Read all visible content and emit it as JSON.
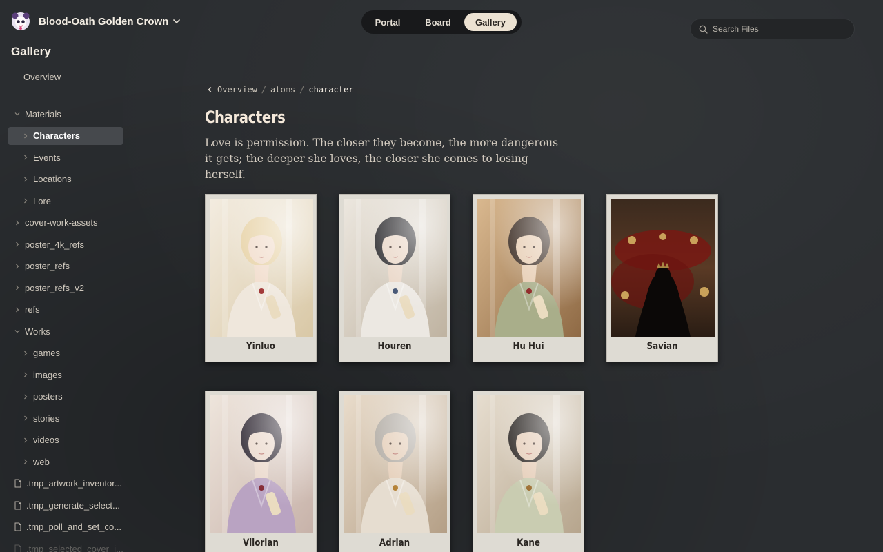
{
  "project": {
    "name": "Blood-Oath Golden Crown",
    "logo_icon": "skull-avatar-icon"
  },
  "nav": {
    "tabs": [
      "Portal",
      "Board",
      "Gallery"
    ],
    "active": "Gallery"
  },
  "search": {
    "placeholder": "Search Files"
  },
  "sidebar": {
    "section_title": "Gallery",
    "overview_label": "Overview",
    "tree": [
      {
        "label": "Materials",
        "type": "folder",
        "expanded": true
      },
      {
        "label": "Characters",
        "type": "folder",
        "active": true
      },
      {
        "label": "Events",
        "type": "folder"
      },
      {
        "label": "Locations",
        "type": "folder"
      },
      {
        "label": "Lore",
        "type": "folder"
      },
      {
        "label": "cover-work-assets",
        "type": "folder"
      },
      {
        "label": "poster_4k_refs",
        "type": "folder"
      },
      {
        "label": "poster_refs",
        "type": "folder"
      },
      {
        "label": "poster_refs_v2",
        "type": "folder"
      },
      {
        "label": "refs",
        "type": "folder"
      },
      {
        "label": "Works",
        "type": "folder",
        "expanded": true
      },
      {
        "label": "games",
        "type": "folder"
      },
      {
        "label": "images",
        "type": "folder"
      },
      {
        "label": "posters",
        "type": "folder"
      },
      {
        "label": "stories",
        "type": "folder"
      },
      {
        "label": "videos",
        "type": "folder"
      },
      {
        "label": "web",
        "type": "folder"
      },
      {
        "label": ".tmp_artwork_inventor...",
        "type": "file"
      },
      {
        "label": ".tmp_generate_select...",
        "type": "file"
      },
      {
        "label": ".tmp_poll_and_set_co...",
        "type": "file"
      },
      {
        "label": ".tmp_selected_cover_i...",
        "type": "file"
      }
    ]
  },
  "breadcrumb": {
    "items": [
      "Overview",
      "atoms"
    ],
    "current": "character"
  },
  "page": {
    "title": "Characters",
    "description": "Love is permission. The closer they become, the more dangerous it gets; the deeper she loves, the closer she comes to losing herself."
  },
  "characters": [
    {
      "name": "Yinluo"
    },
    {
      "name": "Houren"
    },
    {
      "name": "Hu Hui"
    },
    {
      "name": "Savian"
    },
    {
      "name": "Vilorian"
    },
    {
      "name": "Adrian"
    },
    {
      "name": "Kane"
    }
  ],
  "colors": {
    "background": "#2a2d30",
    "accent": "#ece2d2",
    "card": "#dedbd3"
  }
}
